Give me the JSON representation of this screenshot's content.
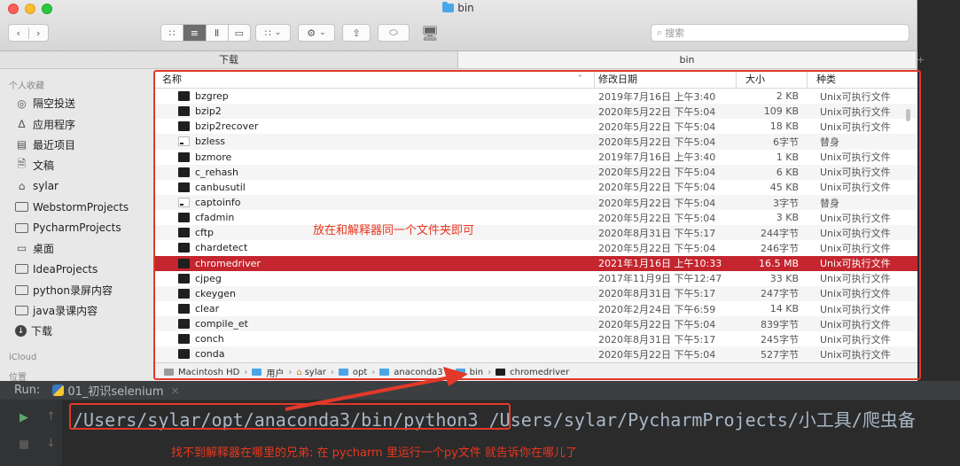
{
  "window": {
    "title": "bin"
  },
  "toolbar": {
    "back_icon": "chevron-left-icon",
    "forward_icon": "chevron-right-icon",
    "view_buttons": [
      "icon-view",
      "list-view",
      "column-view",
      "gallery-view"
    ],
    "search_placeholder": "搜索"
  },
  "tabs": [
    {
      "label": "下载",
      "active": false
    },
    {
      "label": "bin",
      "active": true
    }
  ],
  "sidebar": {
    "section_favorites": "个人收藏",
    "items": [
      {
        "label": "隔空投送",
        "icon": "airdrop-icon"
      },
      {
        "label": "应用程序",
        "icon": "applications-icon"
      },
      {
        "label": "最近项目",
        "icon": "recents-icon"
      },
      {
        "label": "文稿",
        "icon": "documents-icon"
      },
      {
        "label": "sylar",
        "icon": "home-icon"
      },
      {
        "label": "WebstormProjects",
        "icon": "folder-icon"
      },
      {
        "label": "PycharmProjects",
        "icon": "folder-icon"
      },
      {
        "label": "桌面",
        "icon": "desktop-icon"
      },
      {
        "label": "IdeaProjects",
        "icon": "folder-icon"
      },
      {
        "label": "python录屏内容",
        "icon": "folder-icon"
      },
      {
        "label": "java录课内容",
        "icon": "folder-icon"
      },
      {
        "label": "下载",
        "icon": "downloads-icon"
      }
    ],
    "section_icloud": "iCloud",
    "section_location": "位置"
  },
  "columns": {
    "name": "名称",
    "date": "修改日期",
    "size": "大小",
    "kind": "种类"
  },
  "files": [
    {
      "name": "bzgrep",
      "date": "2019年7月16日 上午3:40",
      "size": "2 KB",
      "kind": "Unix可执行文件",
      "type": "exec"
    },
    {
      "name": "bzip2",
      "date": "2020年5月22日 下午5:04",
      "size": "109 KB",
      "kind": "Unix可执行文件",
      "type": "exec"
    },
    {
      "name": "bzip2recover",
      "date": "2020年5月22日 下午5:04",
      "size": "18 KB",
      "kind": "Unix可执行文件",
      "type": "exec"
    },
    {
      "name": "bzless",
      "date": "2020年5月22日 下午5:04",
      "size": "6字节",
      "kind": "替身",
      "type": "alias"
    },
    {
      "name": "bzmore",
      "date": "2019年7月16日 上午3:40",
      "size": "1 KB",
      "kind": "Unix可执行文件",
      "type": "exec"
    },
    {
      "name": "c_rehash",
      "date": "2020年5月22日 下午5:04",
      "size": "6 KB",
      "kind": "Unix可执行文件",
      "type": "exec"
    },
    {
      "name": "canbusutil",
      "date": "2020年5月22日 下午5:04",
      "size": "45 KB",
      "kind": "Unix可执行文件",
      "type": "exec"
    },
    {
      "name": "captoinfo",
      "date": "2020年5月22日 下午5:04",
      "size": "3字节",
      "kind": "替身",
      "type": "alias"
    },
    {
      "name": "cfadmin",
      "date": "2020年5月22日 下午5:04",
      "size": "3 KB",
      "kind": "Unix可执行文件",
      "type": "exec"
    },
    {
      "name": "cftp",
      "date": "2020年8月31日 下午5:17",
      "size": "244字节",
      "kind": "Unix可执行文件",
      "type": "exec"
    },
    {
      "name": "chardetect",
      "date": "2020年5月22日 下午5:04",
      "size": "246字节",
      "kind": "Unix可执行文件",
      "type": "exec"
    },
    {
      "name": "chromedriver",
      "date": "2021年1月16日 上午10:33",
      "size": "16.5 MB",
      "kind": "Unix可执行文件",
      "type": "exec",
      "selected": true
    },
    {
      "name": "cjpeg",
      "date": "2017年11月9日 下午12:47",
      "size": "33 KB",
      "kind": "Unix可执行文件",
      "type": "exec"
    },
    {
      "name": "ckeygen",
      "date": "2020年8月31日 下午5:17",
      "size": "247字节",
      "kind": "Unix可执行文件",
      "type": "exec"
    },
    {
      "name": "clear",
      "date": "2020年2月24日 下午6:59",
      "size": "14 KB",
      "kind": "Unix可执行文件",
      "type": "exec"
    },
    {
      "name": "compile_et",
      "date": "2020年5月22日 下午5:04",
      "size": "839字节",
      "kind": "Unix可执行文件",
      "type": "exec"
    },
    {
      "name": "conch",
      "date": "2020年8月31日 下午5:17",
      "size": "245字节",
      "kind": "Unix可执行文件",
      "type": "exec"
    },
    {
      "name": "conda",
      "date": "2020年5月22日 下午5:04",
      "size": "527字节",
      "kind": "Unix可执行文件",
      "type": "exec"
    }
  ],
  "pathbar": [
    "Macintosh HD",
    "用户",
    "sylar",
    "opt",
    "anaconda3",
    "bin",
    "chromedriver"
  ],
  "annotations": {
    "finder_hint": "放在和解释器同一个文件夹即可",
    "console_hint": "找不到解释器在哪里的兄弟: 在 pycharm 里运行一个py文件  就告诉你在哪儿了"
  },
  "run_panel": {
    "label": "Run:",
    "tab_name": "01_初识selenium",
    "interpreter_path": "/Users/sylar/opt/anaconda3/bin/python3",
    "script_path": " /Users/sylar/PycharmProjects/小工具/爬虫备"
  },
  "colors": {
    "selection": "#c4252e",
    "annotation": "#e3382a",
    "console_text": "#a9b7c6"
  }
}
